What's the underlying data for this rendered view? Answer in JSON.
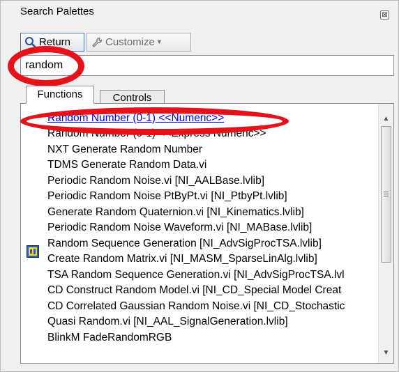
{
  "window": {
    "title": "Search Palettes",
    "close_symbol": "⊠"
  },
  "toolbar": {
    "return_label": "Return",
    "return_icon": "search-icon",
    "customize_label": "Customize",
    "customize_icon": "wrench-icon"
  },
  "search": {
    "value": "random"
  },
  "tabs": [
    {
      "label": "Functions",
      "active": true
    },
    {
      "label": "Controls",
      "active": false
    }
  ],
  "results": [
    {
      "label": "Random Number (0-1)   <<Numeric>>",
      "highlight": true
    },
    {
      "label": "Random Number (0-1)   <<Express Numeric>>"
    },
    {
      "label": "NXT Generate Random Number"
    },
    {
      "label": "TDMS Generate Random Data.vi"
    },
    {
      "label": "Periodic Random Noise.vi [NI_AALBase.lvlib]"
    },
    {
      "label": "Periodic Random Noise PtByPt.vi [NI_PtbyPt.lvlib]"
    },
    {
      "label": "Generate Random Quaternion.vi [NI_Kinematics.lvlib]"
    },
    {
      "label": "Periodic Random Noise Waveform.vi [NI_MABase.lvlib]"
    },
    {
      "label": "Random Sequence Generation [NI_AdvSigProcTSA.lvlib]",
      "icon": "sequence-vi-icon"
    },
    {
      "label": "Create Random Matrix.vi [NI_MASM_SparseLinAlg.lvlib]"
    },
    {
      "label": "TSA Random Sequence Generation.vi [NI_AdvSigProcTSA.lvl"
    },
    {
      "label": "CD Construct Random Model.vi [NI_CD_Special Model Creat"
    },
    {
      "label": "CD Correlated Gaussian Random Noise.vi [NI_CD_Stochastic"
    },
    {
      "label": "Quasi Random.vi [NI_AAL_SignalGeneration.lvlib]"
    },
    {
      "label": "BlinkM FadeRandomRGB"
    }
  ],
  "scrollbar": {
    "up_symbol": "▲",
    "down_symbol": "▼",
    "position": 0.0
  },
  "colors": {
    "annotation": "#e5121a",
    "link": "#0000ee"
  }
}
